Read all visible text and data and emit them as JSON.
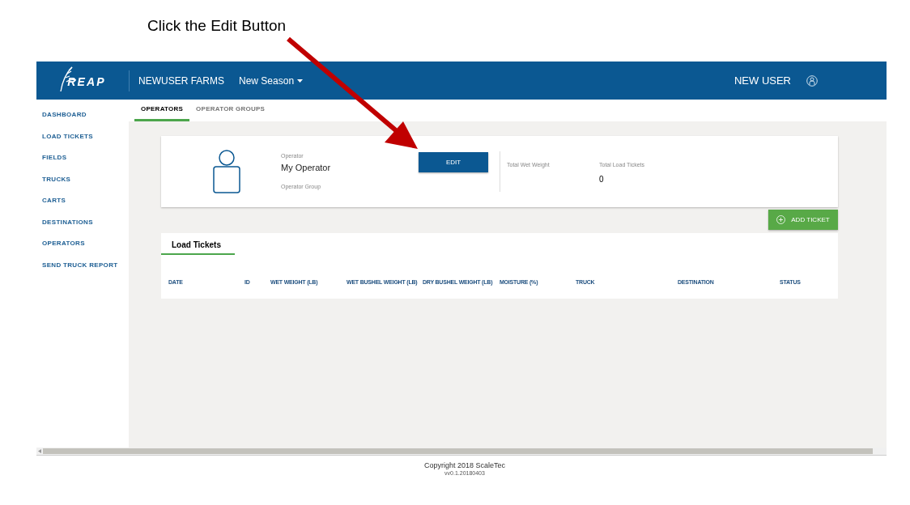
{
  "caption": "Click the Edit Button",
  "header": {
    "logo": "REAP",
    "farm": "NEWUSER FARMS",
    "season": "New Season",
    "user": "NEW USER"
  },
  "sidebar": {
    "items": [
      {
        "label": "DASHBOARD"
      },
      {
        "label": "LOAD TICKETS"
      },
      {
        "label": "FIELDS"
      },
      {
        "label": "TRUCKS"
      },
      {
        "label": "CARTS"
      },
      {
        "label": "DESTINATIONS"
      },
      {
        "label": "OPERATORS"
      },
      {
        "label": "SEND TRUCK REPORT"
      }
    ]
  },
  "tabs": [
    {
      "label": "OPERATORS",
      "selected": true
    },
    {
      "label": "OPERATOR GROUPS",
      "selected": false
    }
  ],
  "operator": {
    "label": "Operator",
    "name": "My Operator",
    "group_label": "Operator Group",
    "edit": "EDIT",
    "stats": [
      {
        "label": "Total Wet Weight"
      },
      {
        "label": "Total Load Tickets",
        "value": "0"
      }
    ]
  },
  "add_ticket": "ADD TICKET",
  "table": {
    "title": "Load Tickets",
    "columns": [
      "DATE",
      "ID",
      "WET WEIGHT (LB)",
      "WET BUSHEL WEIGHT (LB)",
      "DRY BUSHEL WEIGHT (LB)",
      "MOISTURE (%)",
      "TRUCK",
      "DESTINATION",
      "STATUS"
    ]
  },
  "footer": {
    "copyright": "Copyright 2018 ScaleTec",
    "version": "vv0.1.20180403"
  }
}
